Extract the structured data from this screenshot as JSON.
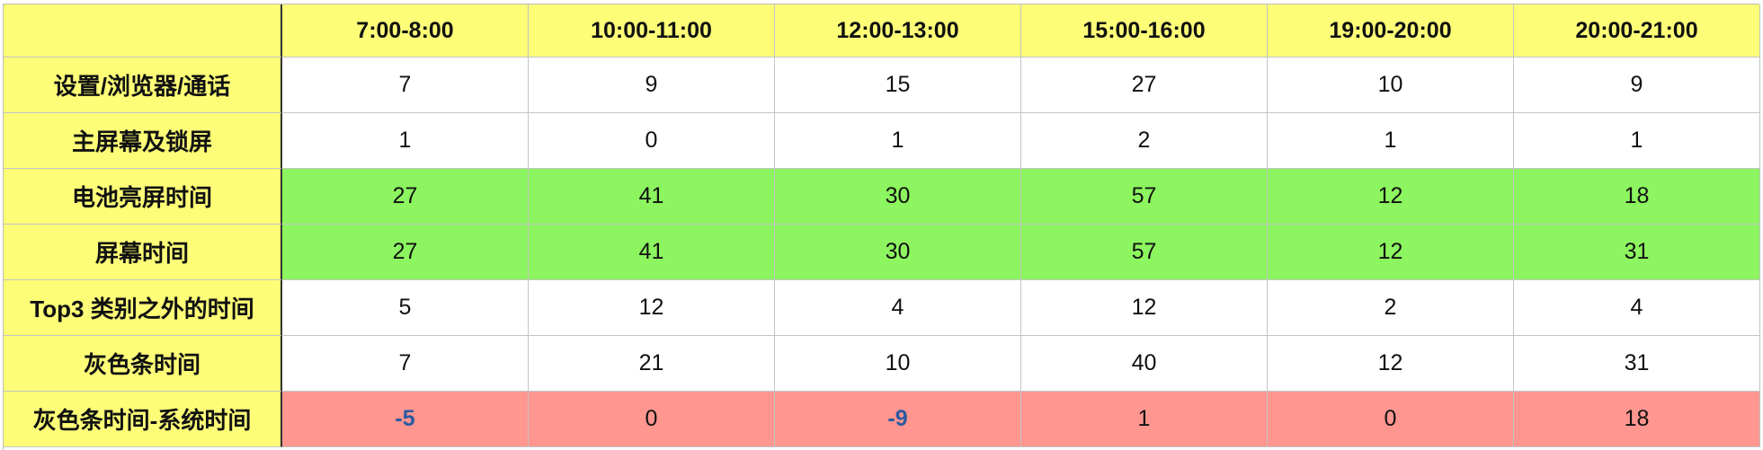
{
  "table": {
    "columns": [
      "7:00-8:00",
      "10:00-11:00",
      "12:00-13:00",
      "15:00-16:00",
      "19:00-20:00",
      "20:00-21:00"
    ],
    "rows": [
      {
        "label": "设置/浏览器/通话",
        "values": [
          "7",
          "9",
          "15",
          "27",
          "10",
          "9"
        ],
        "fill": "white"
      },
      {
        "label": "主屏幕及锁屏",
        "values": [
          "1",
          "0",
          "1",
          "2",
          "1",
          "1"
        ],
        "fill": "white"
      },
      {
        "label": "电池亮屏时间",
        "values": [
          "27",
          "41",
          "30",
          "57",
          "12",
          "18"
        ],
        "fill": "green"
      },
      {
        "label": "屏幕时间",
        "values": [
          "27",
          "41",
          "30",
          "57",
          "12",
          "31"
        ],
        "fill": "green"
      },
      {
        "label": "Top3 类别之外的时间",
        "values": [
          "5",
          "12",
          "4",
          "12",
          "2",
          "4"
        ],
        "fill": "white"
      },
      {
        "label": "灰色条时间",
        "values": [
          "7",
          "21",
          "10",
          "40",
          "12",
          "31"
        ],
        "fill": "white"
      },
      {
        "label": "灰色条时间-系统时间",
        "values": [
          "-5",
          "0",
          "-9",
          "1",
          "0",
          "18"
        ],
        "fill": "red"
      }
    ]
  },
  "colors": {
    "header_yellow": "#fdfd78",
    "highlight_green": "#8cf55f",
    "highlight_red": "#ff9690",
    "negative_text": "#2a5aa0"
  }
}
